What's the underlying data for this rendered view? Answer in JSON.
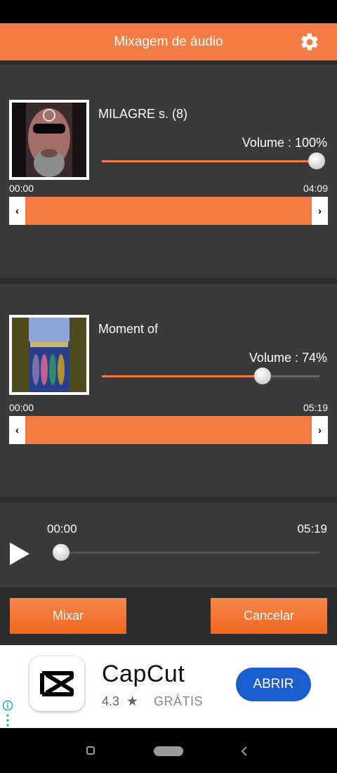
{
  "header": {
    "title": "Mixagem de áudio",
    "settings_icon": "gear-icon"
  },
  "tracks": [
    {
      "title": "MILAGRE s.  (8)",
      "volume_label": "Volume : 100%",
      "volume": 1.0,
      "start_time": "00:00",
      "end_time": "04:09",
      "range_left_arrow": "‹",
      "range_right_arrow": "›"
    },
    {
      "title": "Moment of",
      "volume_label": "Volume : 74%",
      "volume": 0.74,
      "start_time": "00:00",
      "end_time": "05:19",
      "range_left_arrow": "‹",
      "range_right_arrow": "›"
    }
  ],
  "player": {
    "current_time": "00:00",
    "total_time": "05:19",
    "progress": 0.0
  },
  "actions": {
    "mix_label": "Mixar",
    "cancel_label": "Cancelar"
  },
  "ad": {
    "app_name": "CapCut",
    "rating": "4.3",
    "star": "★",
    "price": "GRÁTIS",
    "open_label": "ABRIR"
  },
  "colors": {
    "accent": "#f57c45",
    "ad_button": "#1a5fd0"
  }
}
